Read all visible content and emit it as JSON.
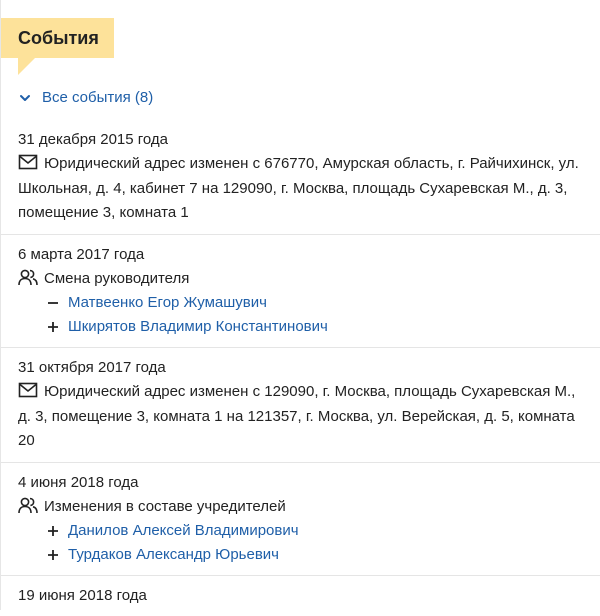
{
  "section": {
    "title": "События"
  },
  "all_events": {
    "label": "Все события (8)"
  },
  "events": [
    {
      "date": "31 декабря 2015 года",
      "icon": "mail-icon",
      "prefix": "Юридический адрес изменен с ",
      "old_address": "676770, Амурская область, г. Райчихинск, ул. Школьная, д. 4, кабинет 7",
      "middle": " на ",
      "new_address": "129090, г. Москва, площадь Сухаревская М., д. 3, помещение 3, комната 1"
    },
    {
      "date": "6 марта 2017 года",
      "icon": "people-icon",
      "title": "Смена руководителя",
      "people": [
        {
          "sign": "minus",
          "name": "Матвеенко Егор Жумашувич"
        },
        {
          "sign": "plus",
          "name": "Шкирятов Владимир Константинович"
        }
      ]
    },
    {
      "date": "31 октября 2017 года",
      "icon": "mail-icon",
      "prefix": "Юридический адрес изменен с ",
      "old_address": "129090, г. Москва, площадь Сухаревская М., д. 3, помещение 3, комната 1",
      "middle": " на ",
      "new_address": "121357, г. Москва, ул. Верейская, д. 5, комната 20"
    },
    {
      "date": "4 июня 2018 года",
      "icon": "people-icon",
      "title": "Изменения в составе учредителей",
      "people": [
        {
          "sign": "plus",
          "name": "Данилов Алексей Владимирович"
        },
        {
          "sign": "plus",
          "name": "Турдаков Александр Юрьевич"
        }
      ]
    },
    {
      "date": "19 июня 2018 года"
    }
  ],
  "colors": {
    "tab_bg": "#fde29a",
    "link": "#1f5fa8",
    "divider": "#e5e5e5"
  }
}
